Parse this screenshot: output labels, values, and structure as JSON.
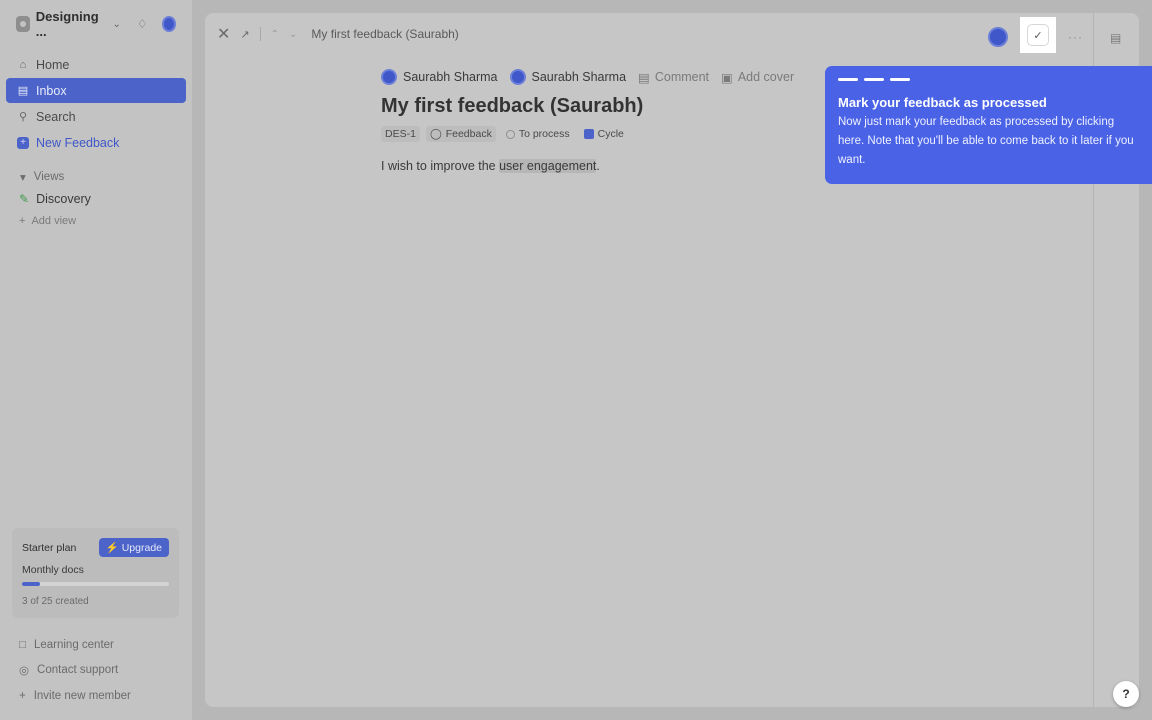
{
  "sidebar": {
    "workspace_name": "Designing ...",
    "nav": [
      {
        "label": "Home",
        "icon": "home-icon"
      },
      {
        "label": "Inbox",
        "icon": "inbox-icon",
        "active": true
      },
      {
        "label": "Search",
        "icon": "search-icon"
      },
      {
        "label": "New Feedback",
        "icon": "plus-icon"
      }
    ],
    "views_label": "Views",
    "views": [
      {
        "label": "Discovery",
        "icon": "pencil-icon"
      }
    ],
    "add_view_label": "Add view",
    "plan": {
      "title": "Starter plan",
      "upgrade_label": "Upgrade",
      "metric_label": "Monthly docs",
      "progress_fraction": 0.12,
      "count_text": "3 of 25 created"
    },
    "footer": [
      {
        "label": "Learning center",
        "icon": "book-icon"
      },
      {
        "label": "Contact support",
        "icon": "support-icon"
      },
      {
        "label": "Invite new member",
        "icon": "plus-icon"
      }
    ]
  },
  "topbar": {
    "breadcrumb": "My first feedback (Saurabh)"
  },
  "doc": {
    "author": "Saurabh Sharma",
    "assignee": "Saurabh Sharma",
    "comment_label": "Comment",
    "add_cover_label": "Add cover",
    "title": "My first feedback (Saurabh)",
    "tags": {
      "id": "DES-1",
      "type": "Feedback",
      "status": "To process",
      "cycle": "Cycle"
    },
    "body_before": "I wish to improve the ",
    "body_highlight": "user engagement",
    "body_after": "."
  },
  "tooltip": {
    "title": "Mark your feedback as processed",
    "body": "Now just mark your feedback as processed by clicking here. Note that you'll be able to come back to it later if you want."
  },
  "help_label": "?",
  "colors": {
    "accent": "#4c63c9",
    "tooltip_bg": "#4a63e6"
  }
}
